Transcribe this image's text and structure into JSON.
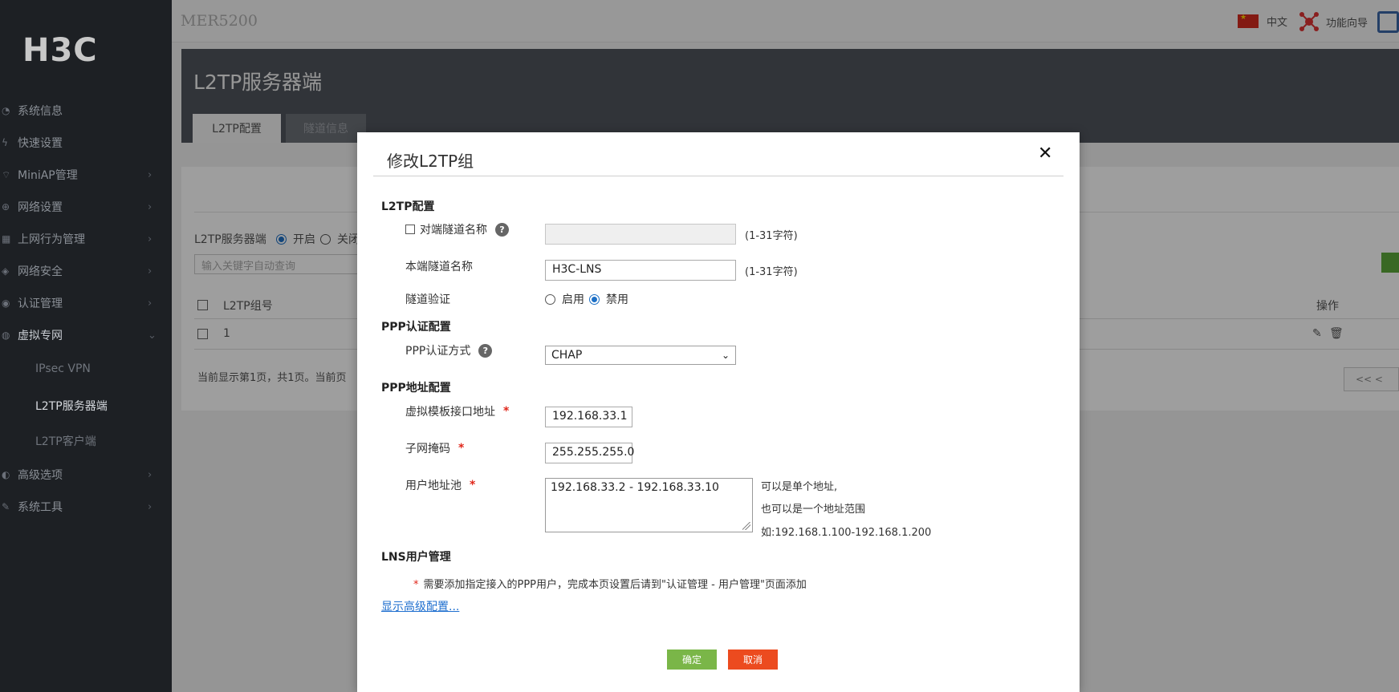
{
  "sidebar": {
    "logo": "H3C",
    "items": [
      {
        "label": "系统信息",
        "icon": "dashboard-icon",
        "chevron": false
      },
      {
        "label": "快速设置",
        "icon": "lightning-icon",
        "chevron": false
      },
      {
        "label": "MiniAP管理",
        "icon": "ap-icon",
        "chevron": true
      },
      {
        "label": "网络设置",
        "icon": "network-icon",
        "chevron": true
      },
      {
        "label": "上网行为管理",
        "icon": "behavior-icon",
        "chevron": true
      },
      {
        "label": "网络安全",
        "icon": "shield-icon",
        "chevron": true
      },
      {
        "label": "认证管理",
        "icon": "auth-icon",
        "chevron": true
      },
      {
        "label": "虚拟专网",
        "icon": "vpn-icon",
        "chevron": true
      }
    ],
    "subitems": [
      {
        "label": "IPsec VPN"
      },
      {
        "label": "L2TP服务器端"
      },
      {
        "label": "L2TP客户端"
      }
    ],
    "bottom_items": [
      {
        "label": "高级选项",
        "icon": "advanced-icon"
      },
      {
        "label": "系统工具",
        "icon": "tools-icon"
      }
    ]
  },
  "header": {
    "device": "MER5200",
    "language": "中文",
    "wizard": "功能向导"
  },
  "page": {
    "title": "L2TP服务器端",
    "tabs": [
      "L2TP配置",
      "隧道信息"
    ]
  },
  "background": {
    "server_label": "L2TP服务器端",
    "on_label": "开启",
    "off_label": "关闭",
    "search_placeholder": "输入关键字自动查询",
    "col_group": "L2TP组号",
    "col_ops": "操作",
    "row_value": "1",
    "pager_text": "当前显示第1页，共1页。当前页",
    "pager_btn": "<< <"
  },
  "modal": {
    "title": "修改L2TP组",
    "close": "✕",
    "sections": {
      "l2tp": "L2TP配置",
      "ppp_auth": "PPP认证配置",
      "ppp_addr": "PPP地址配置",
      "lns_user": "LNS用户管理"
    },
    "fields": {
      "peer_tunnel_label": "对端隧道名称",
      "peer_tunnel_value": "",
      "peer_tunnel_hint": "(1-31字符)",
      "local_tunnel_label": "本端隧道名称",
      "local_tunnel_value": "H3C-LNS",
      "local_tunnel_hint": "(1-31字符)",
      "tunnel_auth_label": "隧道验证",
      "tunnel_auth_enable": "启用",
      "tunnel_auth_disable": "禁用",
      "ppp_auth_label": "PPP认证方式",
      "ppp_auth_value": "CHAP",
      "vt_addr_label": "虚拟模板接口地址",
      "vt_addr_value": "192.168.33.1",
      "mask_label": "子网掩码",
      "mask_value": "255.255.255.0",
      "pool_label": "用户地址池",
      "pool_value": "192.168.33.2 - 192.168.33.10",
      "pool_hint_1": "可以是单个地址,",
      "pool_hint_2": "也可以是一个地址范围",
      "pool_hint_3": "如:192.168.1.100-192.168.1.200"
    },
    "note": "需要添加指定接入的PPP用户，完成本页设置后请到\"认证管理 - 用户管理\"页面添加",
    "advanced_link": "显示高级配置...",
    "ok": "确定",
    "cancel": "取消"
  },
  "colors": {
    "sidebar_bg": "#1d2024",
    "accent_blue": "#1d70c6",
    "ok_green": "#7ab648",
    "cancel_red": "#ec4b1f"
  }
}
